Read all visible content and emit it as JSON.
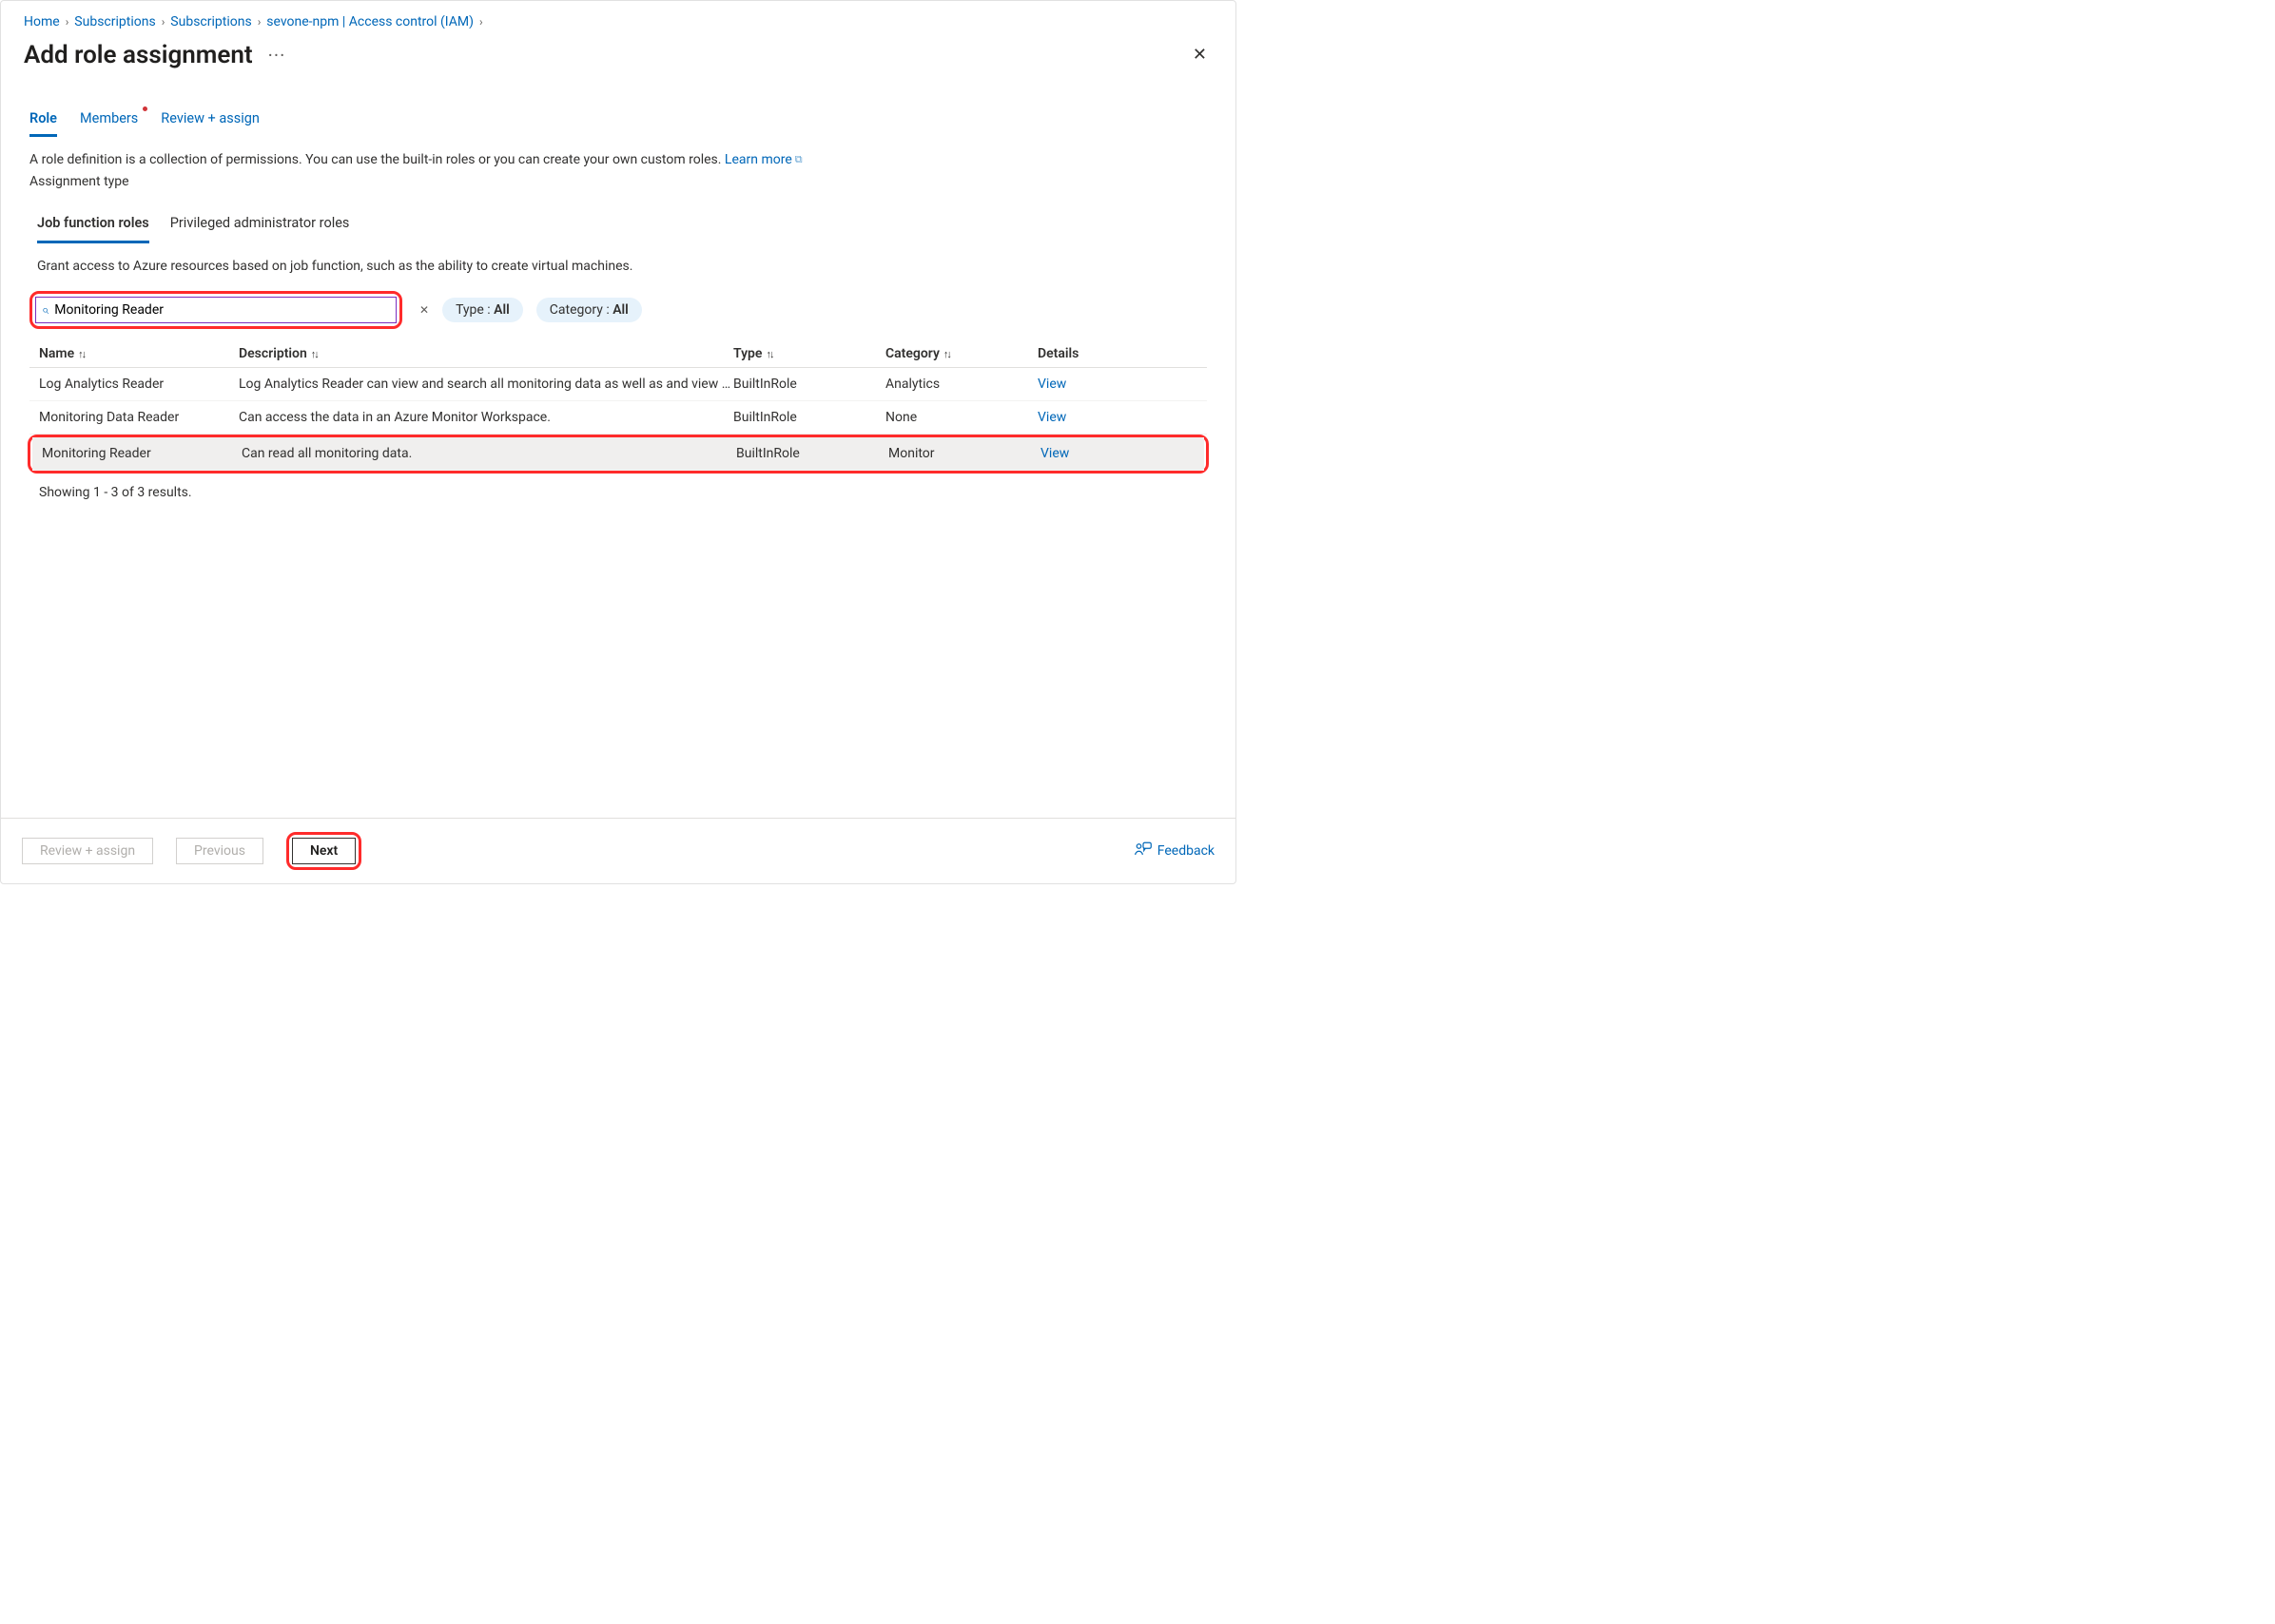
{
  "breadcrumb": {
    "items": [
      "Home",
      "Subscriptions",
      "Subscriptions",
      "sevone-npm | Access control (IAM)"
    ]
  },
  "page": {
    "title": "Add role assignment"
  },
  "steps": {
    "items": [
      {
        "label": "Role",
        "active": true,
        "dot": false
      },
      {
        "label": "Members",
        "active": false,
        "dot": true
      },
      {
        "label": "Review + assign",
        "active": false,
        "dot": false
      }
    ]
  },
  "description": {
    "text": "A role definition is a collection of permissions. You can use the built-in roles or you can create your own custom roles.",
    "learn_more": "Learn more",
    "assignment_type": "Assignment type"
  },
  "subtabs": {
    "items": [
      {
        "label": "Job function roles",
        "active": true
      },
      {
        "label": "Privileged administrator roles",
        "active": false
      }
    ],
    "subdesc": "Grant access to Azure resources based on job function, such as the ability to create virtual machines."
  },
  "filterbar": {
    "search_value": "Monitoring Reader",
    "type_pill_prefix": "Type : ",
    "type_pill_value": "All",
    "cat_pill_prefix": "Category : ",
    "cat_pill_value": "All"
  },
  "table": {
    "headers": {
      "name": "Name",
      "desc": "Description",
      "type": "Type",
      "cat": "Category",
      "det": "Details"
    },
    "rows": [
      {
        "name": "Log Analytics Reader",
        "desc": "Log Analytics Reader can view and search all monitoring data as well as and view …",
        "type": "BuiltInRole",
        "cat": "Analytics",
        "view": "View",
        "selected": false
      },
      {
        "name": "Monitoring Data Reader",
        "desc": "Can access the data in an Azure Monitor Workspace.",
        "type": "BuiltInRole",
        "cat": "None",
        "view": "View",
        "selected": false
      },
      {
        "name": "Monitoring Reader",
        "desc": "Can read all monitoring data.",
        "type": "BuiltInRole",
        "cat": "Monitor",
        "view": "View",
        "selected": true
      }
    ],
    "result_count": "Showing 1 - 3 of 3 results."
  },
  "footer": {
    "review": "Review + assign",
    "previous": "Previous",
    "next": "Next",
    "feedback": "Feedback"
  }
}
